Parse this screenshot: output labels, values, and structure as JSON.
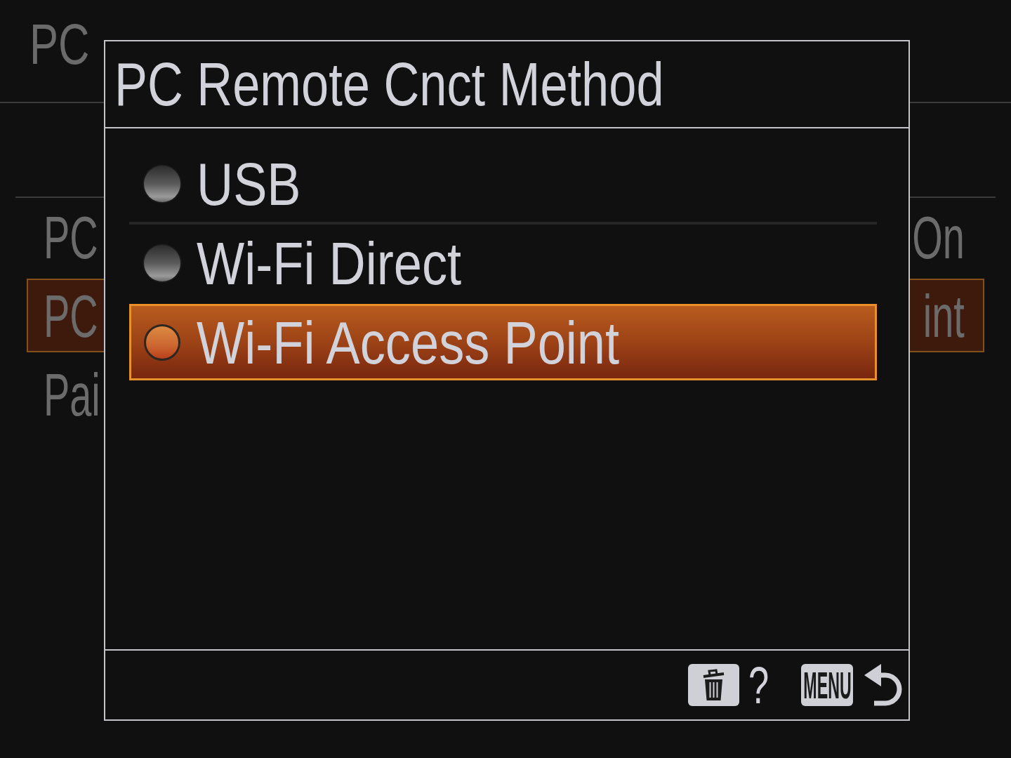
{
  "background_menu": {
    "title": "PC",
    "rows": [
      {
        "label": "PC",
        "value": "On",
        "selected": false
      },
      {
        "label": "PC",
        "value": "int",
        "selected": true
      },
      {
        "label": "Pai",
        "selected": false
      }
    ]
  },
  "dialog": {
    "title": "PC Remote Cnct Method",
    "options": [
      {
        "label": "USB",
        "selected": false
      },
      {
        "label": "Wi-Fi Direct",
        "selected": false
      },
      {
        "label": "Wi-Fi Access Point",
        "selected": true
      }
    ],
    "footer": {
      "help_key": "?",
      "menu_key": "MENU"
    }
  }
}
